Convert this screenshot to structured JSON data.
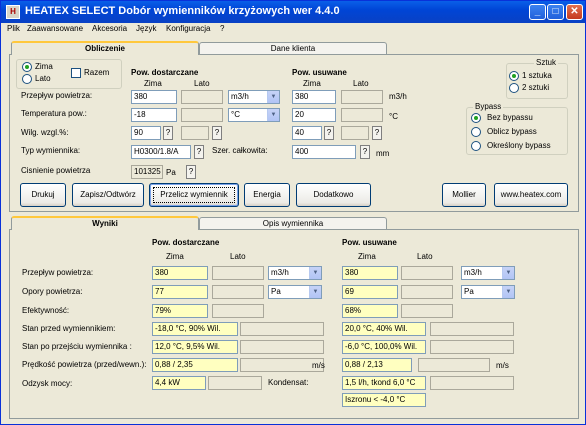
{
  "window": {
    "title": "HEATEX SELECT   Dobór wymienników krzyżowych  wer 4.4.0",
    "icon": "H",
    "minimize": "_",
    "maximize": "□",
    "close": "✕"
  },
  "menu": [
    "Plik",
    "Zaawansowane",
    "Akcesoria",
    "Język",
    "Konfiguracja",
    "?"
  ],
  "top_tabs": {
    "active": "Obliczenie",
    "other": "Dane klienta"
  },
  "season": {
    "winter": "Zima",
    "summer": "Lato",
    "frost": "Razem",
    "selected": "Zima"
  },
  "supply": {
    "heading": "Pow. dostarczane",
    "col1": "Zima",
    "col2": "Lato"
  },
  "exhaust": {
    "heading": "Pow. usuwane",
    "col1": "Zima",
    "col2": "Lato"
  },
  "inputs": {
    "airflow_label": "Przepływ powietrza:",
    "airflow_supply": "380",
    "airflow_unit": "m3/h",
    "airflow_exhaust": "380",
    "airflow_exhaust_unit": "m3/h",
    "temp_label": "Temperatura pow.:",
    "temp_supply": "-18",
    "temp_unit": "°C",
    "temp_exhaust": "20",
    "temp_exhaust_unit": "°C",
    "humidity_label": "Wilg. wzgl.%:",
    "humidity_supply": "90",
    "humidity_exhaust": "40",
    "type_label": "Typ wymiennika:",
    "type_value": "H0300/1.8/A",
    "width_label": "Szer. całkowita:",
    "width_value": "400",
    "width_unit": "mm",
    "pressure_label": "Cisnienie powietrza",
    "pressure_value": "101325",
    "pressure_unit": "Pa",
    "q": "?"
  },
  "pieces": {
    "title": "Sztuk",
    "one": "1 sztuka",
    "two": "2 sztuki",
    "selected": "1 sztuka"
  },
  "bypass": {
    "title": "Bypass",
    "opt1": "Bez bypassu",
    "opt2": "Oblicz bypass",
    "opt3": "Określony bypass",
    "selected": "Bez bypassu"
  },
  "buttons": {
    "print": "Drukuj",
    "save": "Zapisz/Odtwórz",
    "calc": "Przelicz wymiennik",
    "energy": "Energia",
    "extra": "Dodatkowo",
    "mollier": "Mollier",
    "web": "www.heatex.com"
  },
  "bottom_tabs": {
    "active": "Wyniki",
    "other": "Opis wymiennika"
  },
  "results": {
    "supply_heading": "Pow. dostarczane",
    "exhaust_heading": "Pow. usuwane",
    "col_winter": "Zima",
    "col_summer": "Lato",
    "airflow_label": "Przepływ powietrza:",
    "airflow_supply": "380",
    "airflow_supply_unit": "m3/h",
    "airflow_exhaust": "380",
    "airflow_exhaust_unit": "m3/h",
    "pressure_label": "Opory powietrza:",
    "pressure_supply": "77",
    "pressure_supply_unit": "Pa",
    "pressure_exhaust": "69",
    "pressure_exhaust_unit": "Pa",
    "eff_label": "Efektywność:",
    "eff_supply": "79%",
    "eff_exhaust": "68%",
    "before_label": "Stan przed wymiennikiem:",
    "before_supply": "-18,0 °C,  90% Wil.",
    "before_exhaust": "20,0 °C,  40% Wil.",
    "after_label": "Stan po przejściu wymiennika :",
    "after_supply": "12,0 °C, 9,5% Wil.",
    "after_exhaust": "-6,0 °C, 100,0% Wil.",
    "velocity_label": "Prędkość powietrza (przed/wewn.):",
    "velocity_supply": "0,88 / 2,35",
    "velocity_exhaust": "0,88 / 2,13",
    "velocity_unit": "m/s",
    "power_label": "Odzysk mocy:",
    "power_value": "4,4 kW",
    "condensate_label": "Kondensat:",
    "condensate_value": "1,5 l/h, tkond 6,0 °C",
    "frost_value": "Iszronu < -4,0 °C"
  }
}
